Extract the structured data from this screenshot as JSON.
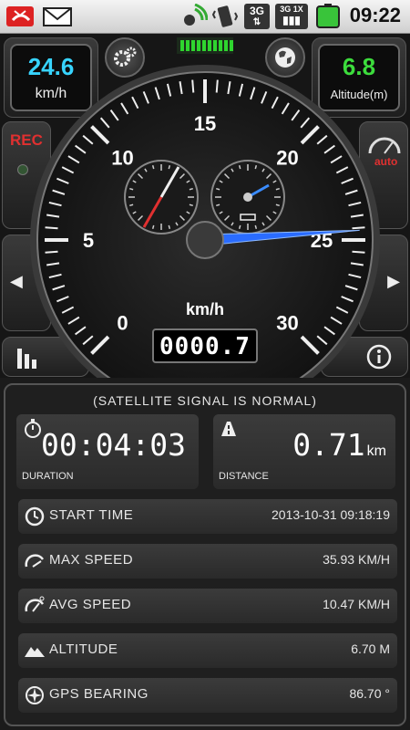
{
  "status_bar": {
    "time": "09:22",
    "icons": [
      "missed-call-icon",
      "email-icon",
      "gps-icon",
      "vibrate-icon",
      "3g-data-icon",
      "3g-1x-signal-icon",
      "battery-icon"
    ],
    "badge_3g": "3G",
    "badge_3g_1x": "3G 1X"
  },
  "speed_box": {
    "value": "24.6",
    "unit": "km/h"
  },
  "altitude_box": {
    "value": "6.8",
    "unit": "Altitude(m)"
  },
  "rec_button": {
    "label": "REC"
  },
  "auto_button": {
    "label": "auto"
  },
  "gauge": {
    "unit": "km/h",
    "ticks": [
      "0",
      "5",
      "10",
      "15",
      "20",
      "25",
      "30"
    ],
    "odometer": "0000.7",
    "speed_value": 24.6,
    "max_value": 30
  },
  "info": {
    "signal_status": "(SATELLITE SIGNAL IS NORMAL)",
    "duration": {
      "value": "00:04:03",
      "label": "DURATION"
    },
    "distance": {
      "value": "0.71",
      "unit": "km",
      "label": "DISTANCE"
    },
    "rows": [
      {
        "label": "START TIME",
        "value": "2013-10-31 09:18:19",
        "icon": "clock-icon"
      },
      {
        "label": "MAX SPEED",
        "value": "35.93 KM/H",
        "icon": "max-speed-icon"
      },
      {
        "label": "AVG SPEED",
        "value": "10.47 KM/H",
        "icon": "avg-speed-icon"
      },
      {
        "label": "ALTITUDE",
        "value": "6.70 M",
        "icon": "mountain-icon"
      },
      {
        "label": "GPS BEARING",
        "value": "86.70 °",
        "icon": "compass-icon"
      }
    ]
  },
  "colors": {
    "speed": "#37d4ff",
    "altitude": "#3cdc3c",
    "rec": "#e03030",
    "needle": "#2a6cff"
  }
}
